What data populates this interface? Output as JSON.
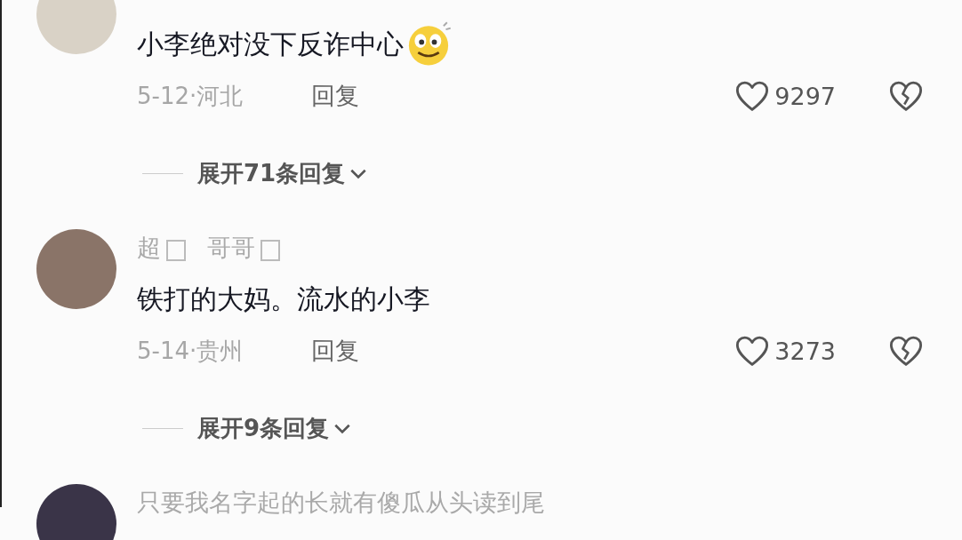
{
  "comments": [
    {
      "text": "小李绝对没下反诈中心",
      "emoji": {
        "kind": "smiley"
      },
      "meta": "5-12·河北",
      "reply": "回复",
      "likes": "9297",
      "expand": "展开71条回复"
    },
    {
      "name_parts": [
        {
          "kind": "text",
          "text": "超"
        },
        {
          "kind": "glyph"
        },
        {
          "kind": "text",
          "text": "哥哥"
        },
        {
          "kind": "glyph"
        }
      ],
      "text": "铁打的大妈。流水的小李",
      "meta": "5-14·贵州",
      "reply": "回复",
      "likes": "3273",
      "expand": "展开9条回复"
    },
    {
      "name_parts": [
        {
          "kind": "text",
          "text": "只要我名字起的长就有傻瓜从头读到尾"
        }
      ]
    }
  ]
}
